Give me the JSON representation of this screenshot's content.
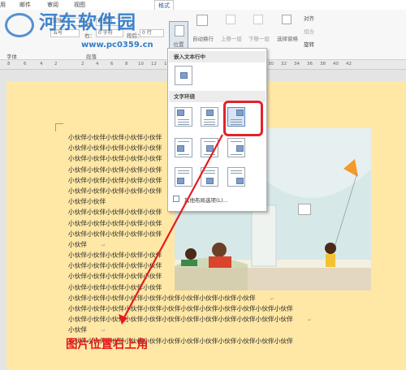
{
  "tabs": [
    "用",
    "邮件",
    "审阅",
    "视图",
    "格式"
  ],
  "watermark": {
    "brand": "河东软件园",
    "url": "www.pc0359.cn"
  },
  "ribbon": {
    "font_name": "宋体",
    "font_size": "五号",
    "group_font": "字体",
    "group_paragraph": "段落",
    "group_style": "样式",
    "left_label": "左：",
    "left_value": "0 字符",
    "right_label": "右：",
    "right_value": "0 字符",
    "spacing_after": "段后：",
    "spacing_after_value": "0 行",
    "position_label": "位置",
    "auto_wrap_label": "自动换行",
    "bring_forward_label": "上移一层",
    "send_backward_label": "下移一层",
    "selection_pane_label": "选择窗格",
    "align_label": "对齐",
    "group_label": "组合",
    "rotate_label": "旋转"
  },
  "ruler": [
    "8",
    "6",
    "4",
    "2",
    "2",
    "4",
    "6",
    "8",
    "10",
    "12",
    "14",
    "16",
    "18",
    "20",
    "22",
    "24",
    "26",
    "28",
    "30",
    "32",
    "34",
    "36",
    "38",
    "40",
    "42"
  ],
  "dropdown": {
    "inline_header": "嵌入文本行中",
    "wrap_header": "文字环绕",
    "more_options": "其他布局选项(L)..."
  },
  "document": {
    "lines": [
      "小伙伴小伙伴小伙伴小伙伴小伙伴",
      "小伙伴小伙伴小伙伴小伙伴小伙伴",
      "小伙伴小伙伴小伙伴小伙伴小伙伴",
      "小伙伴小伙伴小伙伴小伙伴小伙伴",
      "小伙伴小伙伴小伙伴小伙伴小伙伴",
      "小伙伴小伙伴小伙伴小伙伴小伙伴",
      "小伙伴小伙伴",
      "小伙伴小伙伴小伙伴小伙伴小伙伴",
      "小伙伴小伙伴小伙伴小伙伴小伙伴",
      "小伙伴小伙伴小伙伴小伙伴小伙伴",
      "小伙伴",
      "小伙伴小伙伴小伙伴小伙伴小伙伴",
      "小伙伴小伙伴小伙伴小伙伴小伙伴",
      "小伙伴小伙伴小伙伴小伙伴小伙伴",
      "小伙伴小伙伴小伙伴小伙伴小伙伴",
      "小伙伴小伙伴小伙伴小伙伴小伙伴小伙伴小伙伴小伙伴小伙伴小伙伴",
      "小伙伴小伙伴小伙伴小伙伴小伙伴小伙伴小伙伴小伙伴小伙伴小伙伴小伙伴小伙伴",
      "小伙伴小伙伴小伙伴小伙伴小伙伴小伙伴小伙伴小伙伴小伙伴小伙伴小伙伴小伙伴",
      "小伙伴",
      "小伙伴小伙伴小伙伴小伙伴小伙伴小伙伴小伙伴小伙伴小伙伴小伙伴小伙伴小伙伴"
    ]
  },
  "annotation": "图片位置右上角",
  "colors": {
    "annotation_red": "#e21d1d",
    "page_bg": "#ffe8a6",
    "brand_blue": "#1e6fc4"
  }
}
